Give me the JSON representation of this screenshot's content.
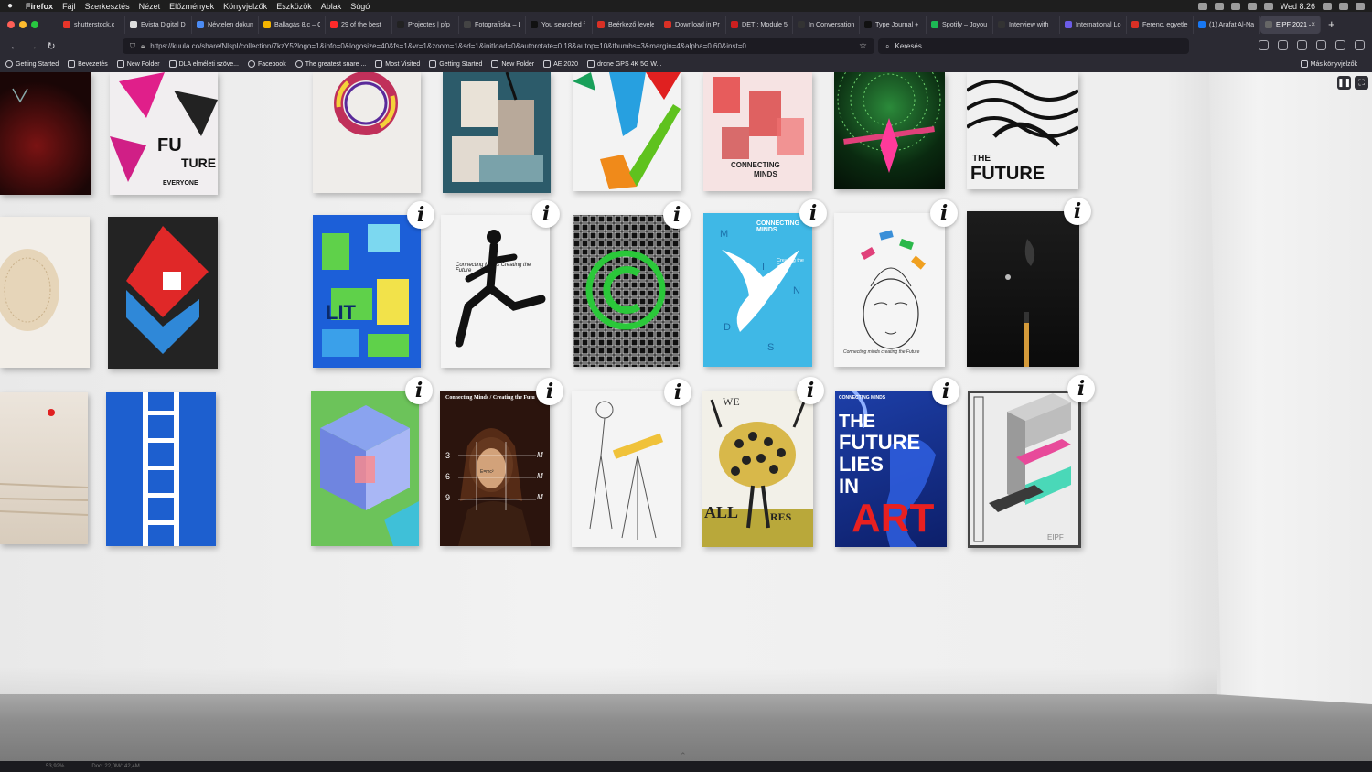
{
  "menubar": {
    "app": "Firefox",
    "items": [
      "Fájl",
      "Szerkesztés",
      "Nézet",
      "Előzmények",
      "Könyvjelzők",
      "Eszközök",
      "Ablak",
      "Súgó"
    ],
    "clock": "Wed 8:26"
  },
  "tabs": [
    {
      "label": "shutterstock.c",
      "color": "#e7352a"
    },
    {
      "label": "Evista Digital D",
      "color": "#dddddd"
    },
    {
      "label": "Névtelen dokum",
      "color": "#4b8bf4"
    },
    {
      "label": "Ballagás 8.c – G",
      "color": "#f4b400"
    },
    {
      "label": "29 of the best",
      "color": "#ff2a2a"
    },
    {
      "label": "Projectes | pfp",
      "color": "#222222"
    },
    {
      "label": "Fotografiska – Logo",
      "color": "#444444"
    },
    {
      "label": "You searched f",
      "color": "#111111"
    },
    {
      "label": "Beérkező levelek",
      "color": "#d93025"
    },
    {
      "label": "Download in Pr",
      "color": "#d93025"
    },
    {
      "label": "DETI: Module 5",
      "color": "#cc1f1f"
    },
    {
      "label": "In Conversation",
      "color": "#333333"
    },
    {
      "label": "Type Journal +",
      "color": "#111111"
    },
    {
      "label": "Spotify – Joyou",
      "color": "#1db954"
    },
    {
      "label": "Interview with",
      "color": "#333333"
    },
    {
      "label": "International Lo",
      "color": "#6c5ce7"
    },
    {
      "label": "Ferenc, egyetlen",
      "color": "#d93025"
    },
    {
      "label": "(1) Arafat Al-Na",
      "color": "#1877f2"
    }
  ],
  "active_tab": {
    "label": "EIPF 2021 –",
    "color": "#666666"
  },
  "url": "https://kuula.co/share/NlspI/collection/7kzY5?logo=1&info=0&logosize=40&fs=1&vr=1&zoom=1&sd=1&initload=0&autorotate=0.18&autop=10&thumbs=3&margin=4&alpha=0.60&inst=0",
  "url_host": "kuula.co",
  "search": {
    "placeholder": "Keresés"
  },
  "bookmarks": [
    {
      "label": "Getting Started",
      "icon": "globe-icon"
    },
    {
      "label": "Bevezetés",
      "icon": "firefox-icon"
    },
    {
      "label": "New Folder",
      "icon": "folder-icon"
    },
    {
      "label": "DLA elméleti szöve...",
      "icon": "folder-icon"
    },
    {
      "label": "Facebook",
      "icon": "globe-icon"
    },
    {
      "label": "The greatest snare ...",
      "icon": "globe-icon"
    },
    {
      "label": "Most Visited",
      "icon": "gear-icon"
    },
    {
      "label": "Getting Started",
      "icon": "firefox-icon"
    },
    {
      "label": "New Folder",
      "icon": "folder-icon"
    },
    {
      "label": "AE 2020",
      "icon": "folder-icon"
    },
    {
      "label": "drone GPS 4K 5G W...",
      "icon": "bookmark-icon"
    }
  ],
  "bookmarks_other": "Más könyvjelzők",
  "posters": {
    "p_future_text_a": "THE",
    "p_future_text_b": "FUTURE",
    "p_everyone": "EVERYONE",
    "p_fu": "FU",
    "p_ture": "TURE",
    "p_connecting": "CONNECTING",
    "p_minds": "MINDS",
    "p_bird_title": "CONNECTING MINDS",
    "p_bird_sub": "Creating the Future",
    "p_bird_letters": [
      "M",
      "I",
      "N",
      "D",
      "S"
    ],
    "p_runner": "Connecting Minds Creating the Future",
    "p_durer_head": "Connecting Minds / Creating the Futu",
    "p_durer_nums": [
      "3",
      "6",
      "9"
    ],
    "p_durer_ms": [
      "M",
      "M",
      "M"
    ],
    "p_durer_eq": "E=mc²",
    "p_art_head": "THE",
    "p_art_future": "FUTURE",
    "p_art_lies": "LIES",
    "p_art_in": "IN",
    "p_art_art": "ART",
    "p_art_small": "CONNECTING MINDS",
    "p_we": "WE",
    "p_all": "ALL",
    "p_res": "RES",
    "p_lit": "LIT",
    "p_buddha": "Connecting minds creating the Future",
    "p_eipf": "EIPF"
  },
  "info_glyph": "i",
  "statusbar": {
    "left": "53,92%",
    "doc": "Doc: 22,0M/142,4M"
  }
}
